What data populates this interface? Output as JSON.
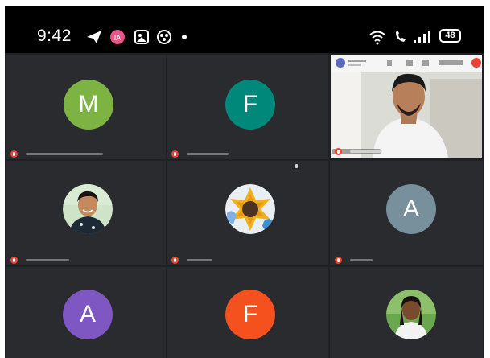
{
  "status_bar": {
    "time": "9:42",
    "battery": "48"
  },
  "icons": {
    "status_left": [
      "telegram-icon",
      "app-badge-icon",
      "gallery-icon",
      "game-icon"
    ],
    "status_right": [
      "wifi-icon",
      "volte-call-icon",
      "signal-icon",
      "battery-icon"
    ]
  },
  "colors": {
    "background": "#202124",
    "tile": "#2a2b2e",
    "mic_muted": "#ea4335",
    "avatar_m": "#7cb342",
    "avatar_f1": "#00897b",
    "avatar_a1": "#78909c",
    "avatar_a2": "#7e57c2",
    "avatar_f2": "#f4511e"
  },
  "participants": [
    {
      "initial": "M",
      "name": "",
      "mic": "muted"
    },
    {
      "initial": "F",
      "name": "",
      "mic": "muted"
    },
    {
      "initial": "",
      "name": "",
      "mic": "muted",
      "video": true
    },
    {
      "initial": "",
      "name": "",
      "mic": "muted"
    },
    {
      "initial": "",
      "name": "",
      "mic": "muted"
    },
    {
      "initial": "A",
      "name": "",
      "mic": "muted"
    },
    {
      "initial": "A",
      "name": "",
      "mic": "muted"
    },
    {
      "initial": "F",
      "name": "",
      "mic": "muted"
    },
    {
      "initial": "",
      "name": "",
      "mic": "muted"
    }
  ]
}
